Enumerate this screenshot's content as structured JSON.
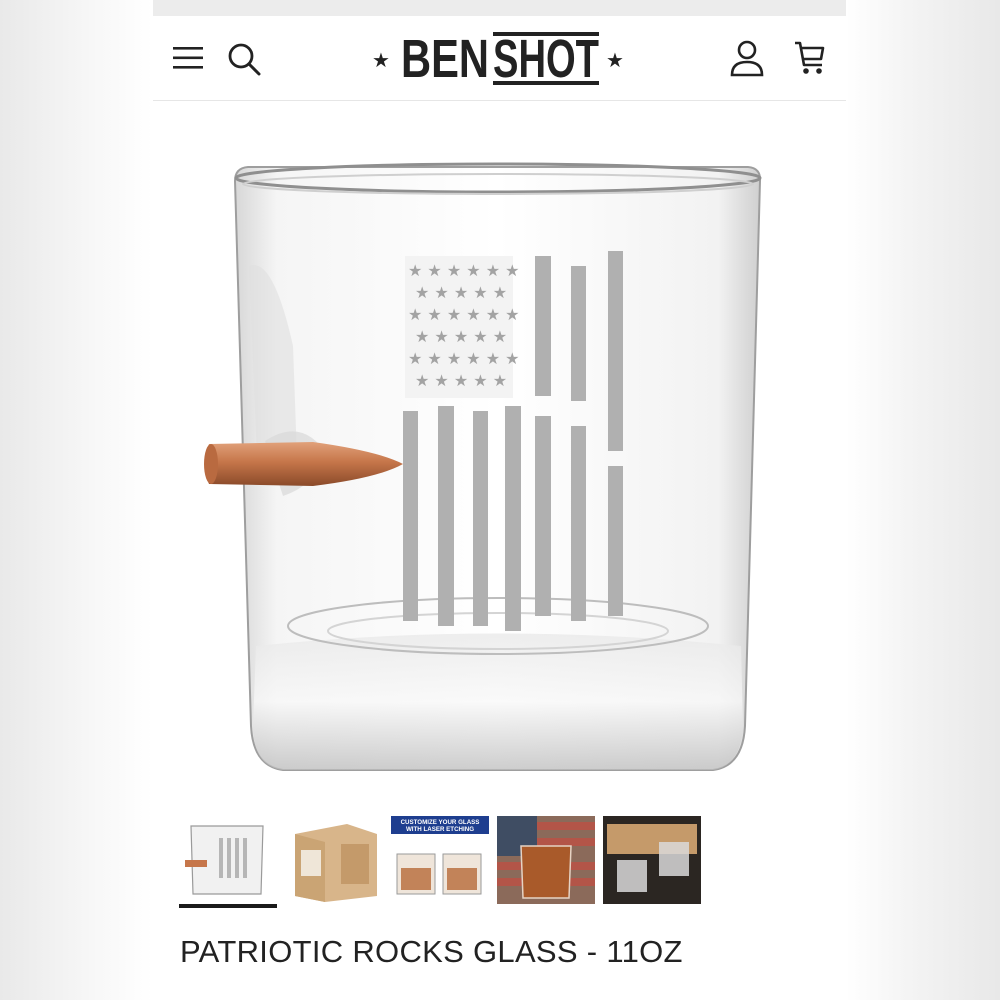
{
  "brand": {
    "name_part1": "BEN",
    "name_part2": "SHOT"
  },
  "header": {
    "menu_icon": "hamburger-menu-icon",
    "search_icon": "search-icon",
    "account_icon": "user-icon",
    "cart_icon": "cart-icon"
  },
  "product": {
    "title": "PATRIOTIC ROCKS GLASS - 11OZ",
    "thumbnails": [
      {
        "name": "rocks glass front"
      },
      {
        "name": "gift box"
      },
      {
        "name": "customize laser etching",
        "caption_line1": "CUSTOMIZE YOUR GLASS",
        "caption_line2": "WITH LASER ETCHING"
      },
      {
        "name": "glass on flag background"
      },
      {
        "name": "glasses in presentation box"
      }
    ]
  },
  "colors": {
    "accent": "#1a1a1a",
    "bullet": "#c6764a"
  }
}
